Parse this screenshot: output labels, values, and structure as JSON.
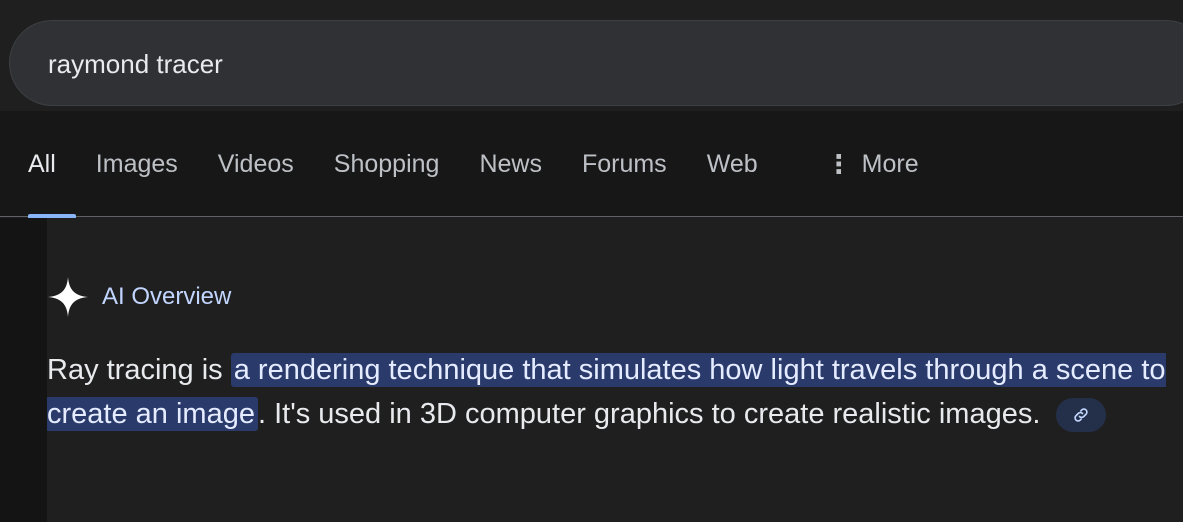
{
  "search": {
    "query": "raymond tracer"
  },
  "tabs": [
    {
      "label": "All",
      "active": true
    },
    {
      "label": "Images"
    },
    {
      "label": "Videos"
    },
    {
      "label": "Shopping"
    },
    {
      "label": "News"
    },
    {
      "label": "Forums"
    },
    {
      "label": "Web"
    },
    {
      "label": "More",
      "icon": "kebab-vertical-icon"
    }
  ],
  "ai_overview": {
    "title": "AI Overview",
    "icon": "sparkle-icon",
    "text_before": "Ray tracing is ",
    "text_highlight": "a rendering technique that simulates how light travels through a scene to create an image",
    "text_after": ". It's used in 3D computer graphics to create realistic images.",
    "link_icon": "link-icon"
  },
  "colors": {
    "background": "#1f1f1f",
    "tabs_background": "#171717",
    "highlight": "#293a6b",
    "accent": "#8ab4f8",
    "ai_title": "#c2d6ff"
  }
}
